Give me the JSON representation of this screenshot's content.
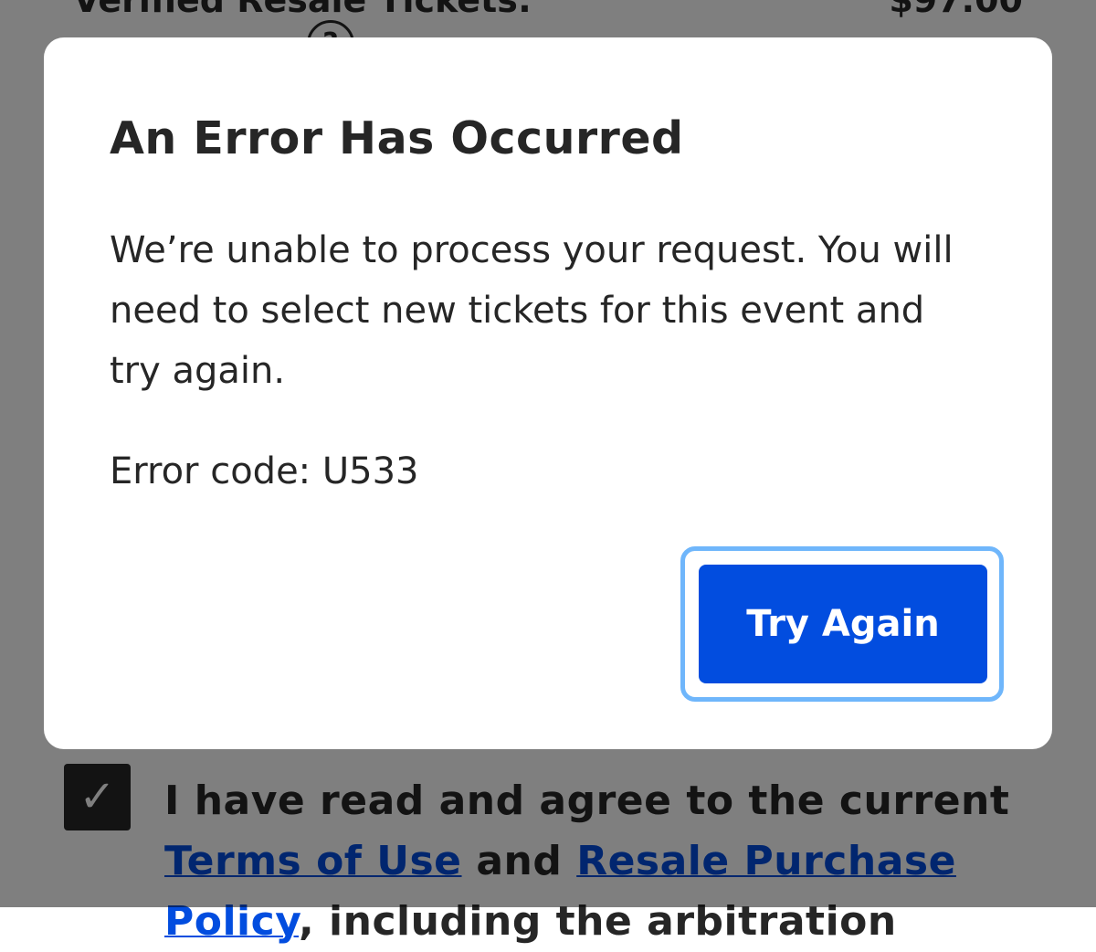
{
  "background": {
    "top_line_label": "Verified Resale Tickets:",
    "top_line_price": "$97.00",
    "agree": {
      "checked": true,
      "prefix": "I have read and agree to the current",
      "terms_link": "Terms of Use",
      "conjunction": "and",
      "policy_link": "Resale Purchase Policy",
      "suffix": ", including the arbitration"
    }
  },
  "modal": {
    "title": "An Error Has Occurred",
    "message": "We’re unable to process your request. You will need to select new tickets for this event and try again.",
    "error_code": "Error code: U533",
    "button_label": "Try Again"
  },
  "colors": {
    "accent": "#024ddf",
    "focus_ring": "#6fb6fb",
    "text": "#262626",
    "overlay": "rgba(0,0,0,0.5)"
  },
  "icons": {
    "help": "question-circle-icon",
    "checkbox": "checkmark-icon"
  }
}
